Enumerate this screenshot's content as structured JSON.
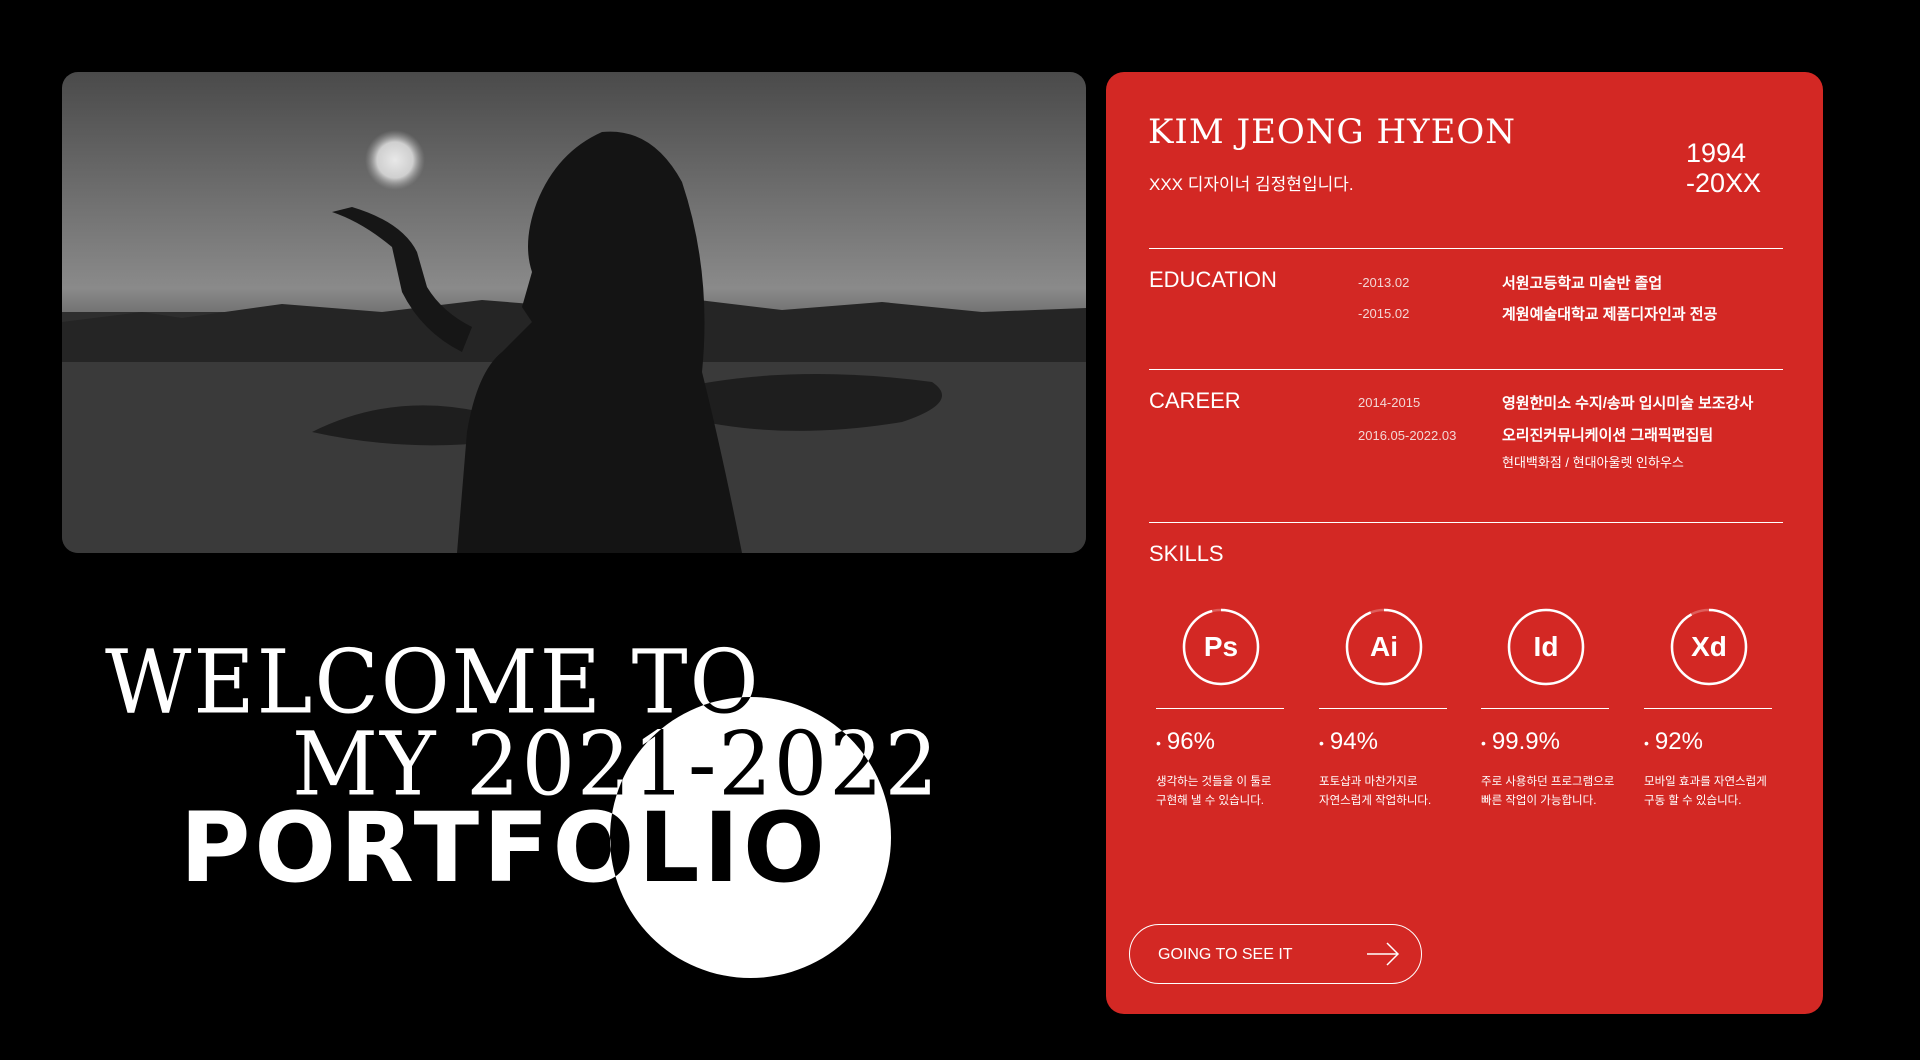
{
  "hero": {
    "line1": "WELCOME TO",
    "line2": "MY 2021-2022",
    "line3": "PORTFOLIO"
  },
  "profile": {
    "name": "KIM JEONG HYEON",
    "intro": "XXX 디자이너 김정현입니다.",
    "year_start": "1994",
    "year_end": "-20XX"
  },
  "education": {
    "title": "EDUCATION",
    "items": [
      {
        "date": "-2013.02",
        "text": "서원고등학교 미술반 졸업"
      },
      {
        "date": "-2015.02",
        "text": "계원예술대학교 제품디자인과 전공"
      }
    ]
  },
  "career": {
    "title": "CAREER",
    "items": [
      {
        "date": "2014-2015",
        "text": "영원한미소 수지/송파 입시미술 보조강사"
      },
      {
        "date": "2016.05-2022.03",
        "text": "오리진커뮤니케이션 그래픽편집팀",
        "sub": "현대백화점 / 현대아울렛 인하우스"
      }
    ]
  },
  "skills": {
    "title": "SKILLS",
    "items": [
      {
        "abbr": "Ps",
        "percent": "96%",
        "level": 0.96,
        "desc1": "생각하는 것들을 이 툴로",
        "desc2": "구현해 낼 수 있습니다."
      },
      {
        "abbr": "Ai",
        "percent": "94%",
        "level": 0.94,
        "desc1": "포토샵과 마찬가지로",
        "desc2": "자연스럽게 작업하니다."
      },
      {
        "abbr": "Id",
        "percent": "99.9%",
        "level": 0.999,
        "desc1": "주로 사용하던 프로그램으로",
        "desc2": "빠른 작업이 가능합니다."
      },
      {
        "abbr": "Xd",
        "percent": "92%",
        "level": 0.92,
        "desc1": "모바일 효과를 자연스럽게",
        "desc2": "구동 할 수 있습니다."
      }
    ]
  },
  "cta": {
    "label": "GOING TO SEE IT",
    "icon": "arrow-right-icon"
  },
  "colors": {
    "background": "#000000",
    "card": "#d32824",
    "text": "#ffffff"
  }
}
